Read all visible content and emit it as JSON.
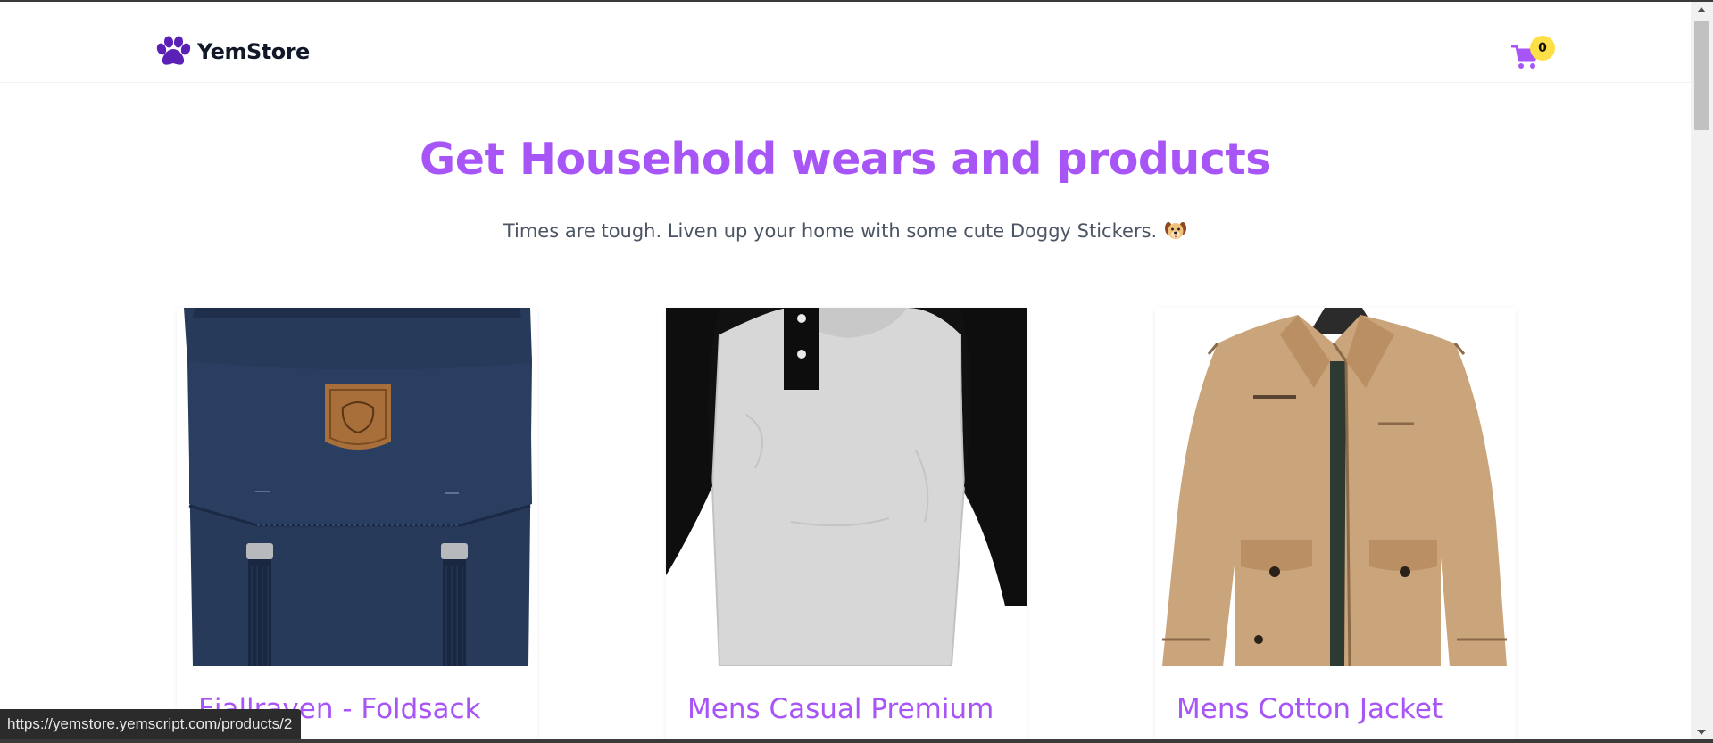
{
  "app": {
    "brand_name": "YemStore",
    "brand_color": "#5b21b6",
    "accent_color": "#a855f7",
    "cart_count": "0",
    "cart_badge_color": "#fde047"
  },
  "hero": {
    "title": "Get Household wears and products",
    "subtitle": "Times are tough. Liven up your home with some cute Doggy Stickers."
  },
  "products": [
    {
      "title": "Fjallraven - Foldsack",
      "image_icon": "backpack-image"
    },
    {
      "title": "Mens Casual Premium",
      "image_icon": "raglan-tshirt-image"
    },
    {
      "title": "Mens Cotton Jacket",
      "image_icon": "cotton-jacket-image"
    }
  ],
  "status_bar": {
    "url": "https://yemstore.yemscript.com/products/2"
  }
}
